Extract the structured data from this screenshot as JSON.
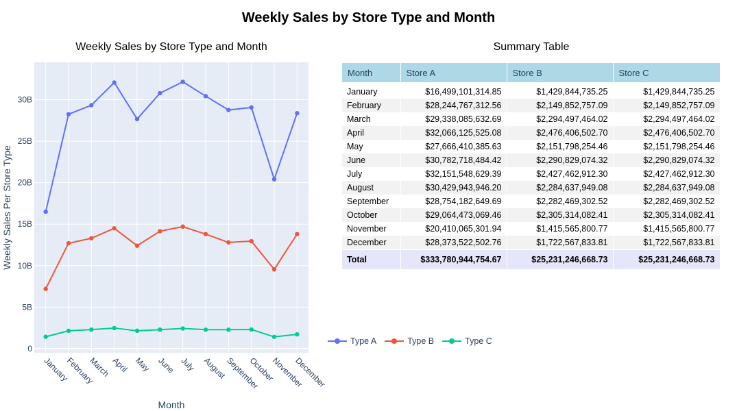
{
  "title": "Weekly Sales by Store Type and Month",
  "chart_title": "Weekly Sales by Store Type and Month",
  "table_title": "Summary Table",
  "chart_data": [
    {
      "type": "line",
      "title": "Weekly Sales by Store Type and Month",
      "xlabel": "Month",
      "ylabel": "Weekly Sales Per Store Type",
      "ylim": [
        -500000000.0,
        34500000000.0
      ],
      "yticks": [
        0,
        5000000000.0,
        10000000000.0,
        15000000000.0,
        20000000000.0,
        25000000000.0,
        30000000000.0
      ],
      "ytick_labels": [
        "0",
        "5B",
        "10B",
        "15B",
        "20B",
        "25B",
        "30B"
      ],
      "categories": [
        "January",
        "February",
        "March",
        "April",
        "May",
        "June",
        "July",
        "August",
        "September",
        "October",
        "November",
        "December"
      ],
      "grid": true,
      "legend_position": "bottom-right",
      "series": [
        {
          "name": "Type A",
          "color": "#636efa",
          "values": [
            16499101314.85,
            28244767312.56,
            29338085632.69,
            32066125525.08,
            27666410385.63,
            30782718484.42,
            32151548629.39,
            30429943946.2,
            28754182649.69,
            29064473069.46,
            20410065301.94,
            28373522502.76
          ]
        },
        {
          "name": "Type B",
          "color": "#ef553b",
          "values": [
            7200000000,
            12700000000,
            13300000000,
            14500000000,
            12400000000,
            14150000000,
            14700000000,
            13800000000,
            12800000000,
            12950000000,
            9550000000,
            13800000000
          ]
        },
        {
          "name": "Type C",
          "color": "#00cc96",
          "values": [
            1429844735.25,
            2149852757.09,
            2294497464.02,
            2476406502.7,
            2151798254.46,
            2290829074.32,
            2427462912.3,
            2284637949.08,
            2282469302.52,
            2305314082.41,
            1415565800.77,
            1722567833.81
          ]
        }
      ]
    },
    {
      "type": "table",
      "title": "Summary Table",
      "columns": [
        "Month",
        "Store A",
        "Store B",
        "Store C"
      ],
      "rows": [
        [
          "January",
          "$16,499,101,314.85",
          "$1,429,844,735.25",
          "$1,429,844,735.25"
        ],
        [
          "February",
          "$28,244,767,312.56",
          "$2,149,852,757.09",
          "$2,149,852,757.09"
        ],
        [
          "March",
          "$29,338,085,632.69",
          "$2,294,497,464.02",
          "$2,294,497,464.02"
        ],
        [
          "April",
          "$32,066,125,525.08",
          "$2,476,406,502.70",
          "$2,476,406,502.70"
        ],
        [
          "May",
          "$27,666,410,385.63",
          "$2,151,798,254.46",
          "$2,151,798,254.46"
        ],
        [
          "June",
          "$30,782,718,484.42",
          "$2,290,829,074.32",
          "$2,290,829,074.32"
        ],
        [
          "July",
          "$32,151,548,629.39",
          "$2,427,462,912.30",
          "$2,427,462,912.30"
        ],
        [
          "August",
          "$30,429,943,946.20",
          "$2,284,637,949.08",
          "$2,284,637,949.08"
        ],
        [
          "September",
          "$28,754,182,649.69",
          "$2,282,469,302.52",
          "$2,282,469,302.52"
        ],
        [
          "October",
          "$29,064,473,069.46",
          "$2,305,314,082.41",
          "$2,305,314,082.41"
        ],
        [
          "November",
          "$20,410,065,301.94",
          "$1,415,565,800.77",
          "$1,415,565,800.77"
        ],
        [
          "December",
          "$28,373,522,502.76",
          "$1,722,567,833.81",
          "$1,722,567,833.81"
        ]
      ],
      "total": [
        "Total",
        "$333,780,944,754.67",
        "$25,231,246,668.73",
        "$25,231,246,668.73"
      ],
      "header_color": "#add8e6",
      "total_color": "#e6e6fa"
    }
  ]
}
